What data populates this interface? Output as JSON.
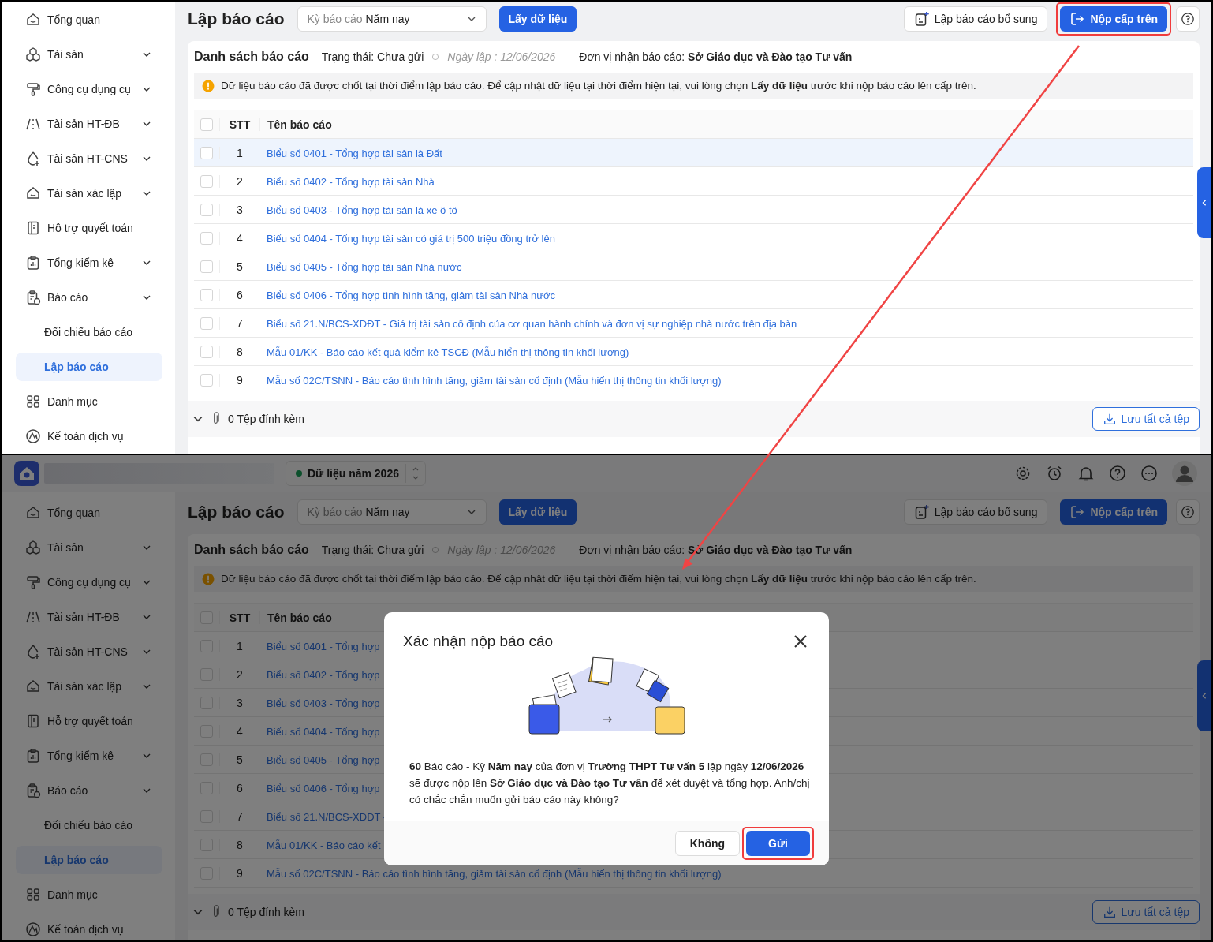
{
  "screens": [
    {
      "sidebar": [
        {
          "label": "Tổng quan",
          "kind": "item",
          "selected": false
        },
        {
          "label": "Tài sản",
          "kind": "group",
          "selected": false
        },
        {
          "label": "Công cụ dụng cụ",
          "kind": "group",
          "selected": false
        },
        {
          "label": "Tài sản HT-ĐB",
          "kind": "group",
          "selected": false
        },
        {
          "label": "Tài sản HT-CNS",
          "kind": "group",
          "selected": false
        },
        {
          "label": "Tài sản xác lập",
          "kind": "group",
          "selected": false
        },
        {
          "label": "Hỗ trợ quyết toán",
          "kind": "item",
          "selected": false
        },
        {
          "label": "Tổng kiểm kê",
          "kind": "group",
          "selected": false
        },
        {
          "label": "Báo cáo",
          "kind": "group",
          "selected": false
        },
        {
          "label": "Đối chiếu báo cáo",
          "kind": "subitem",
          "selected": false
        },
        {
          "label": "Lập báo cáo",
          "kind": "subitem",
          "selected": true
        },
        {
          "label": "Danh mục",
          "kind": "item",
          "selected": false
        },
        {
          "label": "Kế toán dịch vụ",
          "kind": "item",
          "selected": false
        }
      ],
      "title": "Lập báo cáo",
      "period": {
        "label": "Kỳ báo cáo",
        "value": "Năm nay"
      },
      "fetch_button": "Lấy dữ liệu",
      "extra_button": "Lập báo cáo bổ sung",
      "submit_button": {
        "label": "Nộp cấp trên",
        "highlighted": true
      },
      "card": {
        "title": "Danh sách báo cáo",
        "status": "Trạng thái: Chưa gửi",
        "date": "Ngày lập : 12/06/2026",
        "recipient": "Đơn vị nhận báo cáo: **Sở Giáo dục và Đào tạo Tư vấn**",
        "alert": "Dữ liệu báo cáo đã được chốt tại thời điểm lập báo cáo. Để cập nhật dữ liệu tại thời điểm hiện tại, vui lòng chọn **Lấy dữ liệu** trước khi nộp báo cáo lên cấp trên."
      },
      "table": {
        "select_all": {
          "checked": false
        },
        "columns": [
          "STT",
          "Tên báo cáo"
        ],
        "rows": [
          {
            "no": "1",
            "name": "Biểu số 0401 - Tổng hợp tài sản là Đất",
            "selected": true,
            "checked": false
          },
          {
            "no": "2",
            "name": "Biểu số 0402 - Tổng hợp tài sản Nhà",
            "selected": false,
            "checked": false
          },
          {
            "no": "3",
            "name": "Biểu số 0403 - Tổng hợp tài sản là xe ô tô",
            "selected": false,
            "checked": false
          },
          {
            "no": "4",
            "name": "Biểu số 0404 - Tổng hợp tài sản có giá trị 500 triệu đồng trở lên",
            "selected": false,
            "checked": false
          },
          {
            "no": "5",
            "name": "Biểu số 0405 - Tổng hợp tài sản Nhà nước",
            "selected": false,
            "checked": false
          },
          {
            "no": "6",
            "name": "Biểu số 0406 - Tổng hợp tình hình tăng, giảm tài sản Nhà nước",
            "selected": false,
            "checked": false
          },
          {
            "no": "7",
            "name": "Biểu số 21.N/BCS-XDĐT - Giá trị tài sản cố định của cơ quan hành chính và đơn vị sự nghiệp nhà nước trên địa bàn",
            "selected": false,
            "checked": false
          },
          {
            "no": "8",
            "name": "Mẫu 01/KK - Báo cáo kết quả kiểm kê TSCĐ (Mẫu hiển thị thông tin khối lượng)",
            "selected": false,
            "checked": false
          },
          {
            "no": "9",
            "name": "Mẫu số 02C/TSNN - Báo cáo tình hình tăng, giảm tài sản cố định (Mẫu hiển thị thông tin khối lượng)",
            "selected": false,
            "checked": false
          }
        ]
      },
      "attachments": "0 Tệp đính kèm",
      "save_button": "Lưu tất cả tệp"
    },
    {
      "header": {
        "year": "Dữ liệu năm 2026"
      },
      "sidebar": [
        {
          "label": "Tổng quan",
          "kind": "item",
          "selected": false
        },
        {
          "label": "Tài sản",
          "kind": "group",
          "selected": false
        },
        {
          "label": "Công cụ dụng cụ",
          "kind": "group",
          "selected": false
        },
        {
          "label": "Tài sản HT-ĐB",
          "kind": "group",
          "selected": false
        },
        {
          "label": "Tài sản HT-CNS",
          "kind": "group",
          "selected": false
        },
        {
          "label": "Tài sản xác lập",
          "kind": "group",
          "selected": false
        },
        {
          "label": "Hỗ trợ quyết toán",
          "kind": "item",
          "selected": false
        },
        {
          "label": "Tổng kiểm kê",
          "kind": "group",
          "selected": false
        },
        {
          "label": "Báo cáo",
          "kind": "group",
          "selected": false
        },
        {
          "label": "Đối chiếu báo cáo",
          "kind": "subitem",
          "selected": false
        },
        {
          "label": "Lập báo cáo",
          "kind": "subitem",
          "selected": true
        },
        {
          "label": "Danh mục",
          "kind": "item",
          "selected": false
        },
        {
          "label": "Kế toán dịch vụ",
          "kind": "item",
          "selected": false
        }
      ],
      "title": "Lập báo cáo",
      "period": {
        "label": "Kỳ báo cáo",
        "value": "Năm nay"
      },
      "fetch_button": "Lấy dữ liệu",
      "extra_button": "Lập báo cáo bổ sung",
      "submit_button": {
        "label": "Nộp cấp trên",
        "highlighted": false
      },
      "card": {
        "title": "Danh sách báo cáo",
        "status": "Trạng thái: Chưa gửi",
        "date": "Ngày lập : 12/06/2026",
        "recipient": "Đơn vị nhận báo cáo: **Sở Giáo dục và Đào tạo Tư vấn**",
        "alert": "Dữ liệu báo cáo đã được chốt tại thời điểm lập báo cáo. Để cập nhật dữ liệu tại thời điểm hiện tại, vui lòng chọn **Lấy dữ liệu** trước khi nộp báo cáo lên cấp trên."
      },
      "table": {
        "select_all": {
          "checked": false
        },
        "columns": [
          "STT",
          "Tên báo cáo"
        ],
        "rows": [
          {
            "no": "1",
            "name": "Biểu số 0401 - Tổng hợp",
            "checked": false
          },
          {
            "no": "2",
            "name": "Biểu số 0402 - Tổng hợp",
            "checked": false
          },
          {
            "no": "3",
            "name": "Biểu số 0403 - Tổng hợp",
            "checked": false
          },
          {
            "no": "4",
            "name": "Biểu số 0404 - Tổng hợp",
            "checked": false
          },
          {
            "no": "5",
            "name": "Biểu số 0405 - Tổng hợp",
            "checked": false
          },
          {
            "no": "6",
            "name": "Biểu số 0406 - Tổng hợp",
            "checked": false
          },
          {
            "no": "7",
            "name": "Biểu số 21.N/BCS-XDĐT -",
            "checked": false
          },
          {
            "no": "8",
            "name": "Mẫu 01/KK - Báo cáo kết",
            "checked": false
          },
          {
            "no": "9",
            "name": "Mẫu số 02C/TSNN - Báo cáo tình hình tăng, giảm tài sản cố định (Mẫu hiển thị thông tin khối lượng)",
            "checked": false
          }
        ]
      },
      "attachments": "0 Tệp đính kèm",
      "save_button": "Lưu tất cả tệp",
      "modal": {
        "title": "Xác nhận nộp báo cáo",
        "message": "**60** Báo cáo - Kỳ **Năm nay** của đơn vị **Trường THPT Tư vấn 5** lập ngày **12/06/2026** sẽ được nộp lên **Sở Giáo dục và Đào tạo Tư vấn** để xét duyệt và tổng hợp. Anh/chị có chắc chắn muốn gửi báo cáo này không?",
        "buttons": [
          {
            "label": "Không",
            "kind": "secondary",
            "highlighted": false
          },
          {
            "label": "Gửi",
            "kind": "primary",
            "highlighted": true
          }
        ]
      }
    }
  ]
}
